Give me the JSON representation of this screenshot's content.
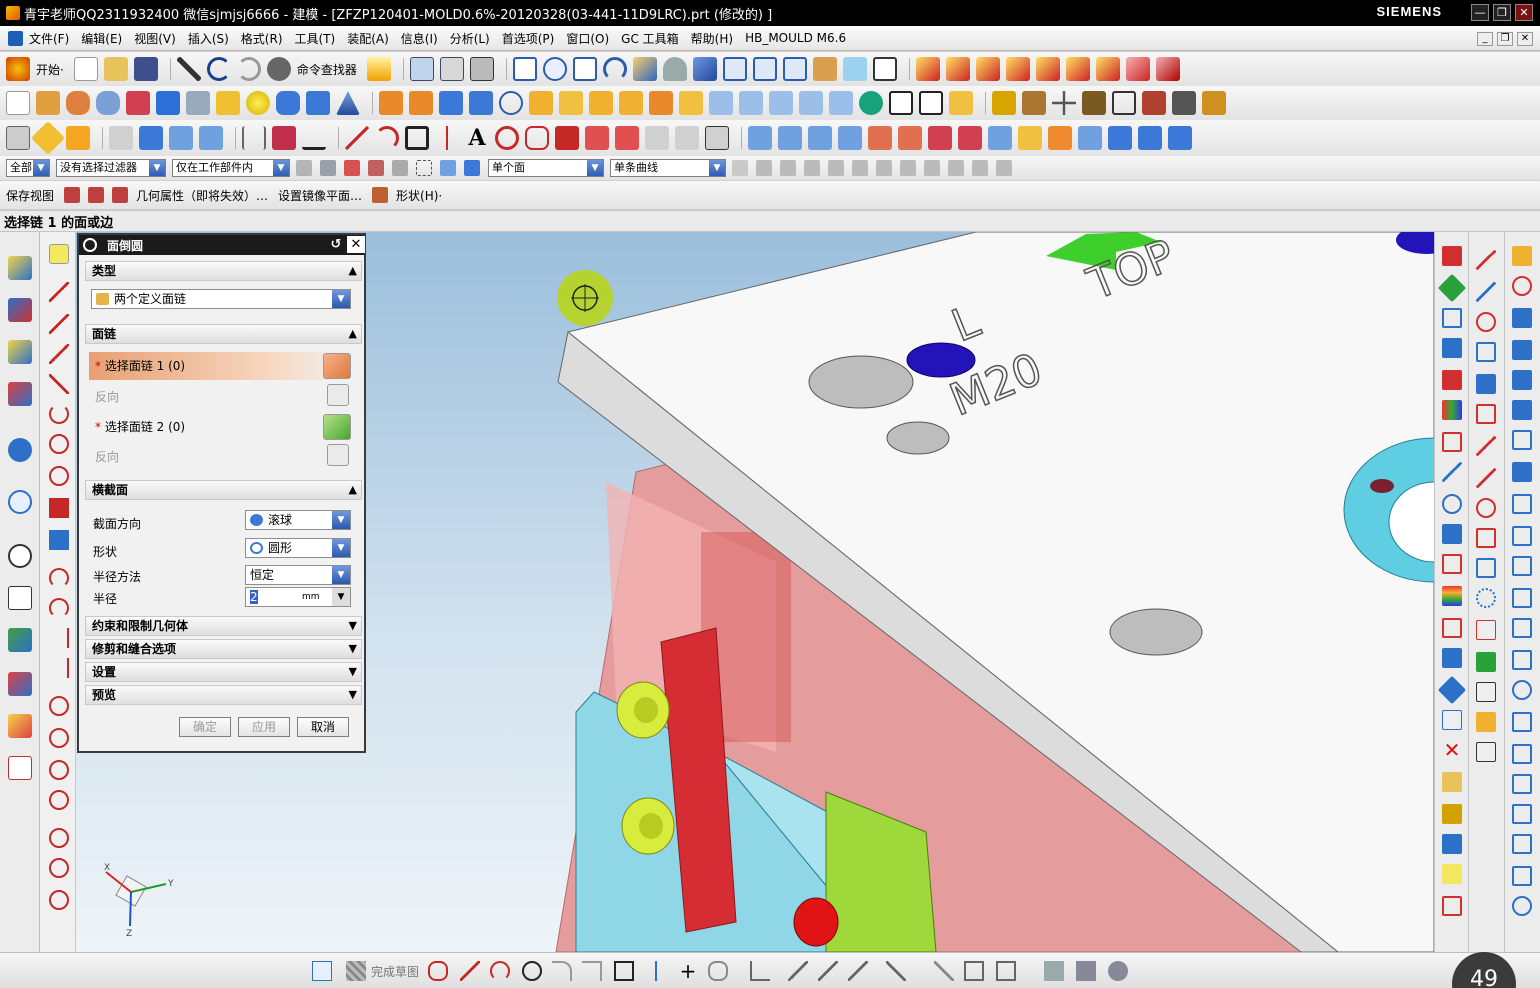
{
  "window": {
    "title": "青宇老师QQ2311932400 微信sjmjsj6666 - 建模 - [ZFZP120401-MOLD0.6%-20120328(03-441-11D9LRC).prt  (修改的) ]",
    "brand": "SIEMENS",
    "minimize": "—",
    "maximize": "❐",
    "close": "✕"
  },
  "menubar": {
    "items": [
      "文件(F)",
      "编辑(E)",
      "视图(V)",
      "插入(S)",
      "格式(R)",
      "工具(T)",
      "装配(A)",
      "信息(I)",
      "分析(L)",
      "首选项(P)",
      "窗口(O)",
      "GC 工具箱",
      "帮助(H)",
      "HB_MOULD M6.6"
    ],
    "mdi": [
      "_",
      "❐",
      "✕"
    ]
  },
  "toolbar1": {
    "start_label": "开始·",
    "command_finder": "命令查找器"
  },
  "toolbar4": {
    "filter_all": "全部",
    "no_filter": "没有选择过滤器",
    "work_part_only": "仅在工作部件内",
    "single_face": "单个面",
    "single_curve": "单条曲线"
  },
  "toolbar5": {
    "items": [
      "保存视图",
      "几何属性（即将失效）…",
      "设置镜像平面…",
      "形状(H)·"
    ]
  },
  "cue_line": "选择链 1 的面或边",
  "dialog": {
    "title": "面倒圆",
    "sections": {
      "type": "类型",
      "face_chain": "面链",
      "cross_section": "横截面",
      "constraints": "约束和限制几何体",
      "trim": "修剪和缝合选项",
      "settings": "设置",
      "preview": "预览"
    },
    "type_value": "两个定义面链",
    "select_chain1": "选择面链 1 (0)",
    "reverse1": "反向",
    "select_chain2": "选择面链 2 (0)",
    "reverse2": "反向",
    "section_orientation_label": "截面方向",
    "section_orientation_value": "滚球",
    "shape_label": "形状",
    "shape_value": "圆形",
    "radius_method_label": "半径方法",
    "radius_method_value": "恒定",
    "radius_label": "半径",
    "radius_value": "2",
    "radius_unit": "mm",
    "ok": "确定",
    "apply": "应用",
    "cancel": "取消"
  },
  "model": {
    "text_top": "TOP",
    "text_m20": "M20",
    "text_l": "L"
  },
  "triad": {
    "x": "X",
    "y": "Y",
    "z": "Z"
  },
  "bottombar": {
    "finish_sketch": "完成草图"
  },
  "timer": "49"
}
